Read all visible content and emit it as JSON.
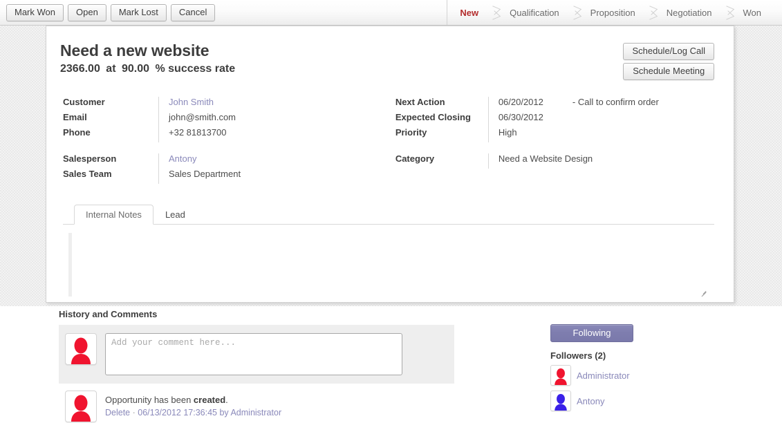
{
  "toolbar": {
    "buttons": [
      {
        "label": "Mark Won",
        "name": "mark-won-button"
      },
      {
        "label": "Open",
        "name": "open-button"
      },
      {
        "label": "Mark Lost",
        "name": "mark-lost-button"
      },
      {
        "label": "Cancel",
        "name": "cancel-button"
      }
    ]
  },
  "statusbar": {
    "active_color": "#b32d2d",
    "stages": [
      {
        "label": "New",
        "active": true
      },
      {
        "label": "Qualification",
        "active": false
      },
      {
        "label": "Proposition",
        "active": false
      },
      {
        "label": "Negotiation",
        "active": false
      },
      {
        "label": "Won",
        "active": false
      }
    ]
  },
  "record": {
    "title": "Need a new website",
    "amount": "2366.00",
    "at": "at",
    "probability": "90.00",
    "success_text": "% success rate"
  },
  "head_buttons": [
    {
      "label": "Schedule/Log Call",
      "name": "schedule-log-call-button"
    },
    {
      "label": "Schedule Meeting",
      "name": "schedule-meeting-button"
    }
  ],
  "fields": {
    "left": [
      {
        "rows": [
          {
            "label": "Customer",
            "value": "John Smith",
            "link": true
          },
          {
            "label": "Email",
            "value": "john@smith.com",
            "link": false
          },
          {
            "label": "Phone",
            "value": "+32 81813700",
            "link": false
          }
        ]
      },
      {
        "rows": [
          {
            "label": "Salesperson",
            "value": "Antony",
            "link": true
          },
          {
            "label": "Sales Team",
            "value": "Sales Department",
            "link": false
          }
        ]
      }
    ],
    "right": [
      {
        "rows": [
          {
            "label": "Next Action",
            "value": "06/20/2012",
            "extra": "- Call to confirm order",
            "link": false
          },
          {
            "label": "Expected Closing",
            "value": "06/30/2012",
            "link": false
          },
          {
            "label": "Priority",
            "value": "High",
            "link": false
          }
        ]
      },
      {
        "rows": [
          {
            "label": "Category",
            "value": "Need a Website Design",
            "link": false
          }
        ]
      }
    ]
  },
  "notebook": {
    "tabs": [
      {
        "label": "Internal Notes",
        "active": true
      },
      {
        "label": "Lead",
        "active": false
      }
    ],
    "notes_value": ""
  },
  "chatter": {
    "title": "History and Comments",
    "comment_placeholder": "Add your comment here...",
    "comment_value": "",
    "history": [
      {
        "message_prefix": "Opportunity has been ",
        "message_bold": "created",
        "message_suffix": ".",
        "delete_label": "Delete",
        "separator": "·",
        "timestamp": "06/13/2012 17:36:45",
        "by": "by",
        "author": "Administrator",
        "avatar_color": "#f0142f"
      }
    ]
  },
  "followers": {
    "follow_button_label": "Following",
    "follow_button_color": "#7e7dae",
    "title": "Followers (2)",
    "list": [
      {
        "name": "Administrator",
        "avatar_color": "#f0142f"
      },
      {
        "name": "Antony",
        "avatar_color": "#3a21e8"
      }
    ]
  }
}
